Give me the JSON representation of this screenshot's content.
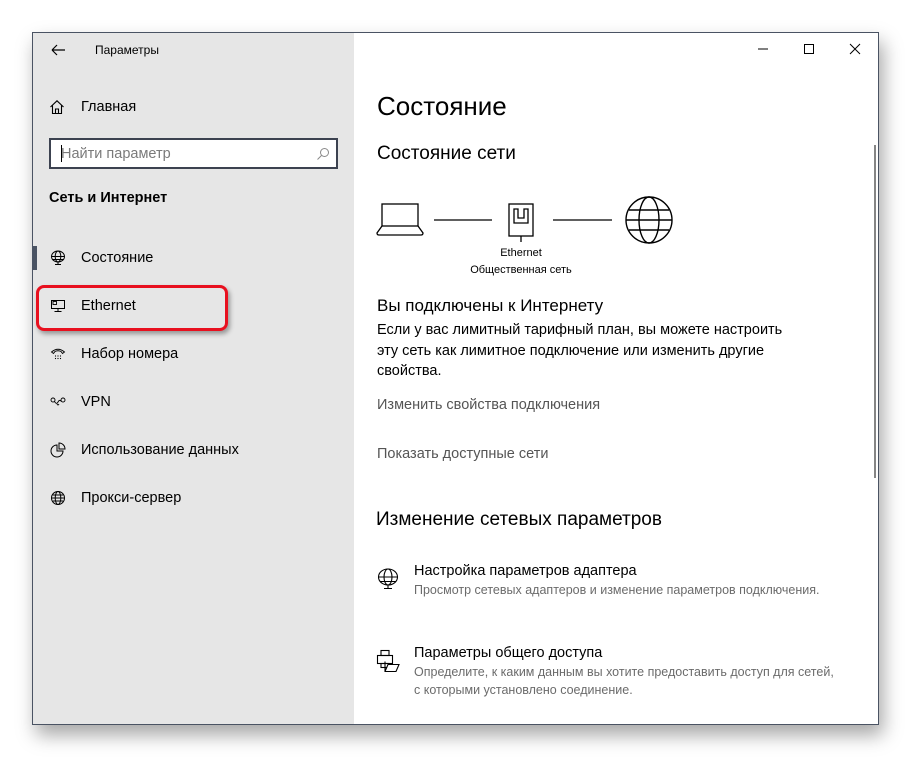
{
  "window": {
    "app_title": "Параметры",
    "controls": {
      "minimize": "minimize-icon",
      "maximize": "maximize-icon",
      "close": "close-icon"
    }
  },
  "sidebar": {
    "back_icon": "arrow-left-icon",
    "home": {
      "icon": "home-icon",
      "label": "Главная"
    },
    "search": {
      "placeholder": "Найти параметр",
      "value": "",
      "icon": "search-icon"
    },
    "section_title": "Сеть и Интернет",
    "items": [
      {
        "icon": "globe-monitor-icon",
        "label": "Состояние",
        "active": true
      },
      {
        "icon": "ethernet-monitor-icon",
        "label": "Ethernet",
        "active": false,
        "highlighted": true
      },
      {
        "icon": "dial-up-phone-icon",
        "label": "Набор номера",
        "active": false
      },
      {
        "icon": "vpn-icon",
        "label": "VPN",
        "active": false
      },
      {
        "icon": "pie-chart-icon",
        "label": "Использование данных",
        "active": false
      },
      {
        "icon": "globe-icon",
        "label": "Прокси-сервер",
        "active": false
      }
    ],
    "highlight_color": "#e8101f"
  },
  "main": {
    "page_title": "Состояние",
    "network_status": {
      "title": "Состояние сети",
      "diagram": {
        "device_icon": "laptop-icon",
        "adapter_icon": "ethernet-port-icon",
        "internet_icon": "globe-icon",
        "adapter_name": "Ethernet",
        "network_type": "Общественная сеть"
      }
    },
    "connected": {
      "title": "Вы подключены к Интернету",
      "description": "Если у вас лимитный тарифный план, вы можете настроить эту сеть как лимитное подключение или изменить другие свойства."
    },
    "links": {
      "change_properties": "Изменить свойства подключения",
      "show_networks": "Показать доступные сети"
    },
    "change_settings": {
      "title": "Изменение сетевых параметров",
      "options": [
        {
          "icon": "globe-monitor-icon",
          "title": "Настройка параметров адаптера",
          "description": "Просмотр сетевых адаптеров и изменение параметров подключения."
        },
        {
          "icon": "printer-folder-icon",
          "title": "Параметры общего доступа",
          "description": "Определите, к каким данным вы хотите предоставить доступ для сетей, с которыми установлено соединение."
        }
      ]
    }
  }
}
